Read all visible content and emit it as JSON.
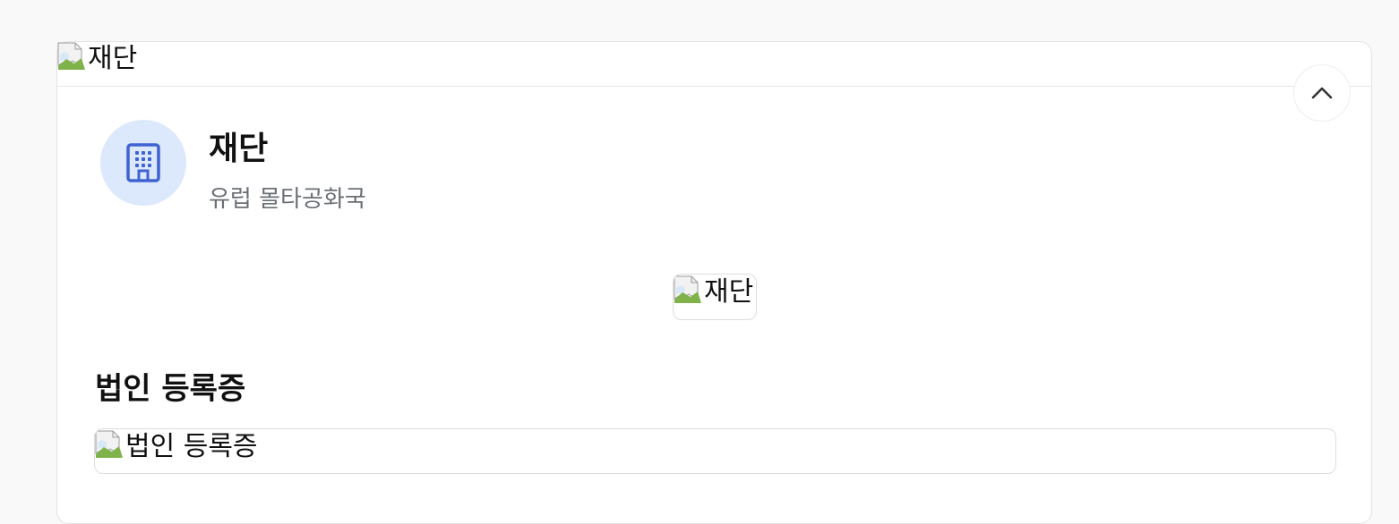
{
  "banner": {
    "image_alt": "재단"
  },
  "header": {
    "collapse_icon": "chevron-up-icon",
    "avatar_icon": "building-icon",
    "name": "재단",
    "country": "유럽 몰타공화국"
  },
  "logo": {
    "image_alt": "재단"
  },
  "certificate": {
    "title": "법인 등록증",
    "image_alt": "법인 등록증"
  },
  "colors": {
    "accent": "#3f63d3",
    "avatar_bg": "#dce8fb",
    "muted_text": "#6b6f76",
    "border": "#dddddd"
  }
}
